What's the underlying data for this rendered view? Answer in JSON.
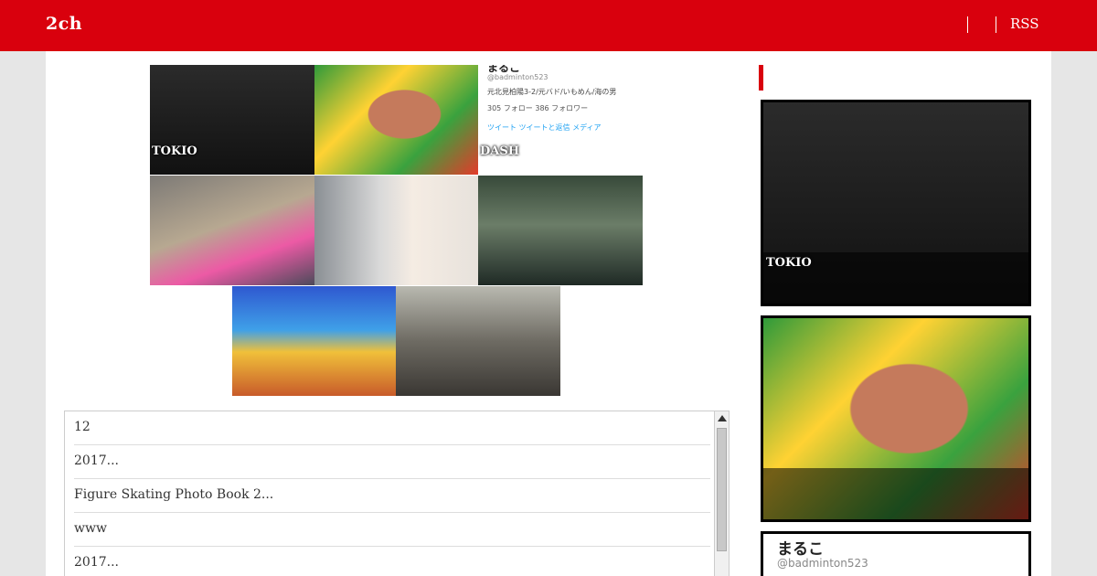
{
  "header": {
    "brand": "2ch",
    "nav": {
      "rss_label": "RSS"
    },
    "accent_color": "#d9000d"
  },
  "gallery": {
    "thumbs": [
      {
        "caption": "TOKIO",
        "photo": "band-photo"
      },
      {
        "caption": "",
        "photo": "clay-figure-tv-photo"
      },
      {
        "caption": "DASH",
        "photo": "tweet-screenshot"
      },
      {
        "caption": "",
        "photo": "street-tv-photo"
      },
      {
        "caption": "",
        "photo": "woman-portrait"
      },
      {
        "caption": "",
        "photo": "man-interview-tv"
      },
      {
        "caption": "",
        "photo": "quiz-show-photo"
      },
      {
        "caption": "",
        "photo": "soldiers-film-still"
      }
    ],
    "tweet": {
      "name": "まるこ",
      "handle": "@badminton523",
      "bio": "元北見柏陽3-2/元バド/いもめん/海の男",
      "stats": "305 フォロー   386 フォロワー",
      "tabs": "ツイート   ツイートと返信   メディア"
    }
  },
  "list": {
    "items": [
      "12",
      "2017...",
      "Figure Skating Photo Book 2...",
      "www",
      "2017..."
    ]
  },
  "sidebar": {
    "cards": [
      {
        "caption": "TOKIO",
        "photo": "band-photo"
      },
      {
        "caption": "",
        "photo": "clay-figure-tv-photo"
      }
    ],
    "tweet_card": {
      "name": "まるこ",
      "handle": "@badminton523"
    }
  }
}
